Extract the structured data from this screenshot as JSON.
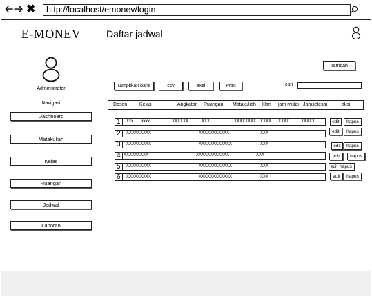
{
  "browser": {
    "url": "http://localhost/emonev/login"
  },
  "header": {
    "brand": "E-MONEV",
    "page_title": "Daftar jadwal"
  },
  "sidebar": {
    "role": "Administrator",
    "nav_title": "Navigasi",
    "items": [
      {
        "label": "Dashboard"
      },
      {
        "label": "Matakuliah"
      },
      {
        "label": "Kelas"
      },
      {
        "label": "Ruangan"
      },
      {
        "label": "Jadwal"
      },
      {
        "label": "Laporan"
      }
    ]
  },
  "toolbar": {
    "add_label": "Tambah",
    "show_rows_label": "Tampilkan baris",
    "csv_label": "csv",
    "excel_label": "exel",
    "print_label": "Print",
    "search_label": "cari",
    "search_value": ""
  },
  "table": {
    "columns": [
      "Dosen",
      "Kelas",
      "Angkatan",
      "Ruangan",
      "Matakuliah",
      "Hari",
      "jam mulai",
      "Jamselesai",
      "aksi"
    ],
    "edit_label": "edit",
    "delete_label": "hapus",
    "rows": [
      {
        "num": "1",
        "dosen": "Xxx",
        "kelas": "xxxx",
        "angkatan": "XXXXXX",
        "ruangan": "XXX",
        "matakuliah": "XXXXXXXX",
        "hari": "XXXX",
        "jam_mulai": "XXXX",
        "jam_selesai": "XXXXX"
      },
      {
        "num": "2",
        "dosen": "XXXXXXXXX",
        "matakuliah": "XXXXXXXXXXX",
        "hari": "XXX"
      },
      {
        "num": "3",
        "dosen": "XXXXXXXXX",
        "matakuliah": "XXXXXXXXXXXX",
        "hari": "XXX"
      },
      {
        "num": "4",
        "dosen": "XXXXXXXXX",
        "matakuliah": "XXXXXXXXXXXX",
        "hari": "XXX"
      },
      {
        "num": "5",
        "dosen": "XXXXXXXXX",
        "matakuliah": "XXXXXXXXXXXX",
        "hari": "XXX"
      },
      {
        "num": "6",
        "dosen": "XXXXXXXXX",
        "matakuliah": "XXXXXXXXXXXX",
        "hari": "XXX"
      }
    ]
  },
  "icons": {
    "back": "back-arrow-icon",
    "forward": "forward-arrow-icon",
    "close": "close-icon",
    "search": "search-icon",
    "user": "user-icon"
  }
}
